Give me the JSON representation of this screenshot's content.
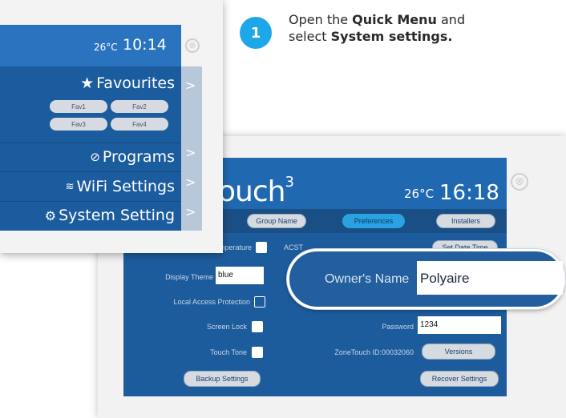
{
  "step": {
    "number": "1",
    "line1_pre": "Open the ",
    "line1_bold": "Quick Menu",
    "line1_post": " and",
    "line2_pre": "select ",
    "line2_bold": "System settings."
  },
  "front_screen": {
    "temperature": "26°C",
    "time": "10:14",
    "close_icon": "⊗",
    "menu": [
      {
        "label": "Favourites",
        "icon": "star-icon"
      },
      {
        "label": "Programs",
        "icon": "clock-icon"
      },
      {
        "label": "WiFi Settings",
        "icon": "wifi-icon"
      },
      {
        "label": "System Setting",
        "icon": "gear-icon"
      }
    ],
    "favourites": [
      "Fav1",
      "Fav2",
      "Fav3",
      "Fav4"
    ],
    "chevron": ">"
  },
  "rear_screen": {
    "logo": "ouch",
    "logo_sup": "3",
    "temperature": "26°C",
    "time": "16:18",
    "close_icon": "⊗",
    "tabs": {
      "group_name": "Group Name",
      "preferences": "Preferences",
      "installers": "Installers"
    },
    "acst": "ACST",
    "set_date_time": "Set Date Time",
    "display_temperature": "Display Temperature",
    "display_theme": {
      "label": "Display Theme",
      "value": "blue"
    },
    "local_access_protection": "Local Access Protection",
    "screen_lock": "Screen Lock",
    "touch_tone": "Touch Tone",
    "password": {
      "label": "Password",
      "value": "1234"
    },
    "zonetouch_id": "ZoneTouch ID:00032060",
    "versions": "Versions",
    "backup_settings": "Backup Settings",
    "recover_settings": "Recover Settings"
  },
  "zoom_callout": {
    "label": "Owner's Name",
    "value": "Polyaire"
  },
  "colors": {
    "accent": "#1ea7e8",
    "panel_blue": "#1d5c9c",
    "header_blue": "#2068b0"
  }
}
